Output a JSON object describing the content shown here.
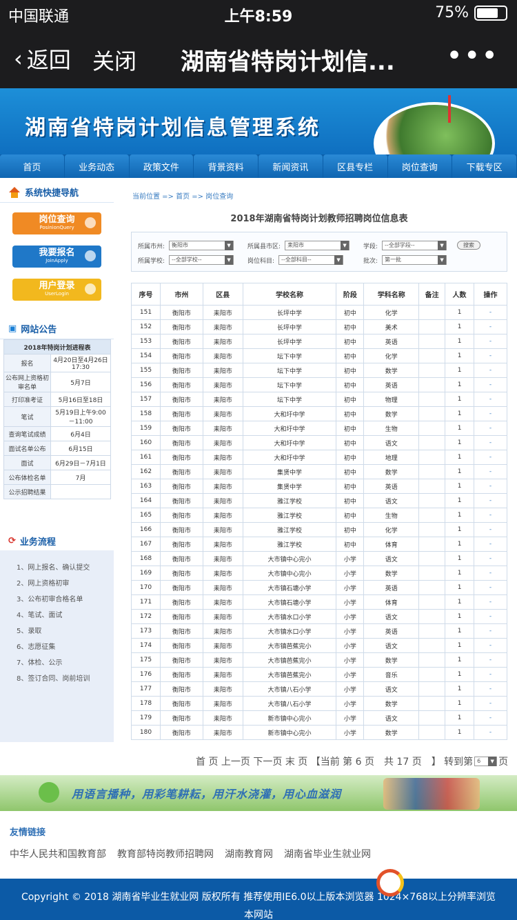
{
  "statusbar": {
    "carrier": "中国联通",
    "time": "上午8:59",
    "battery": "75%",
    "battery_level": 0.75
  },
  "navbar": {
    "back": "返回",
    "close": "关闭",
    "title": "湖南省特岗计划信...",
    "more": "•••"
  },
  "site": {
    "title": "湖南省特岗计划信息管理系统",
    "menu": [
      "首页",
      "业务动态",
      "政策文件",
      "背景资料",
      "新闻资讯",
      "区县专栏",
      "岗位查询",
      "下载专区"
    ]
  },
  "sidebar": {
    "quick_nav": "系统快捷导航",
    "buttons": [
      {
        "label": "岗位查询",
        "sub": "PosinionQuery",
        "color": "#f08a24"
      },
      {
        "label": "我要报名",
        "sub": "JoinApply",
        "color": "#1f78c8"
      },
      {
        "label": "用户登录",
        "sub": "UserLogin",
        "color": "#f2b81e"
      }
    ],
    "notice_title": "网站公告",
    "plan_caption": "2018年特岗计划进程表",
    "plan": [
      {
        "k": "报名",
        "v": "4月20日至4月26日17:30"
      },
      {
        "k": "公布网上资格初审名单",
        "v": "5月7日"
      },
      {
        "k": "打印准考证",
        "v": "5月16日至18日"
      },
      {
        "k": "笔试",
        "v": "5月19日上午9:00－11:00"
      },
      {
        "k": "查询笔试成绩",
        "v": "6月4日"
      },
      {
        "k": "面试名单公布",
        "v": "6月15日"
      },
      {
        "k": "面试",
        "v": "6月29日－7月1日"
      },
      {
        "k": "公布体检名单",
        "v": "7月"
      },
      {
        "k": "公示招聘结果",
        "v": ""
      }
    ],
    "flow_title": "业务流程",
    "flow": [
      "1、网上报名、确认提交",
      "2、网上资格初审",
      "3、公布初审合格名单",
      "4、笔试、面试",
      "5、录取",
      "6、志愿征集",
      "7、体检、公示",
      "8、签订合同、岗前培训"
    ]
  },
  "main": {
    "breadcrumb": "当前位置 => 首页 => 岗位查询",
    "heading": "2018年湖南省特岗计划教师招聘岗位信息表",
    "filters": {
      "city_label": "所属市州:",
      "city": "衡阳市",
      "county_label": "所属县市区:",
      "county": "耒阳市",
      "stage_label": "学段:",
      "stage": "--全部学段--",
      "search": "搜索",
      "school_label": "所属学校:",
      "school": "--全部学校--",
      "subject_label": "岗位科目:",
      "subject": "--全部科目--",
      "batch_label": "批次:",
      "batch": "第一批"
    },
    "columns": [
      "序号",
      "市州",
      "区县",
      "学校名称",
      "阶段",
      "学科名称",
      "备注",
      "人数",
      "操作"
    ],
    "rows": [
      [
        "151",
        "衡阳市",
        "耒阳市",
        "长坪中学",
        "初中",
        "化学",
        "",
        "1",
        "-"
      ],
      [
        "152",
        "衡阳市",
        "耒阳市",
        "长坪中学",
        "初中",
        "美术",
        "",
        "1",
        "-"
      ],
      [
        "153",
        "衡阳市",
        "耒阳市",
        "长坪中学",
        "初中",
        "英语",
        "",
        "1",
        "-"
      ],
      [
        "154",
        "衡阳市",
        "耒阳市",
        "坛下中学",
        "初中",
        "化学",
        "",
        "1",
        "-"
      ],
      [
        "155",
        "衡阳市",
        "耒阳市",
        "坛下中学",
        "初中",
        "数学",
        "",
        "1",
        "-"
      ],
      [
        "156",
        "衡阳市",
        "耒阳市",
        "坛下中学",
        "初中",
        "英语",
        "",
        "1",
        "-"
      ],
      [
        "157",
        "衡阳市",
        "耒阳市",
        "坛下中学",
        "初中",
        "物理",
        "",
        "1",
        "-"
      ],
      [
        "158",
        "衡阳市",
        "耒阳市",
        "大和圩中学",
        "初中",
        "数学",
        "",
        "1",
        "-"
      ],
      [
        "159",
        "衡阳市",
        "耒阳市",
        "大和圩中学",
        "初中",
        "生物",
        "",
        "1",
        "-"
      ],
      [
        "160",
        "衡阳市",
        "耒阳市",
        "大和圩中学",
        "初中",
        "语文",
        "",
        "1",
        "-"
      ],
      [
        "161",
        "衡阳市",
        "耒阳市",
        "大和圩中学",
        "初中",
        "地理",
        "",
        "1",
        "-"
      ],
      [
        "162",
        "衡阳市",
        "耒阳市",
        "集贤中学",
        "初中",
        "数学",
        "",
        "1",
        "-"
      ],
      [
        "163",
        "衡阳市",
        "耒阳市",
        "集贤中学",
        "初中",
        "英语",
        "",
        "1",
        "-"
      ],
      [
        "164",
        "衡阳市",
        "耒阳市",
        "雅江学校",
        "初中",
        "语文",
        "",
        "1",
        "-"
      ],
      [
        "165",
        "衡阳市",
        "耒阳市",
        "雅江学校",
        "初中",
        "生物",
        "",
        "1",
        "-"
      ],
      [
        "166",
        "衡阳市",
        "耒阳市",
        "雅江学校",
        "初中",
        "化学",
        "",
        "1",
        "-"
      ],
      [
        "167",
        "衡阳市",
        "耒阳市",
        "雅江学校",
        "初中",
        "体育",
        "",
        "1",
        "-"
      ],
      [
        "168",
        "衡阳市",
        "耒阳市",
        "大市镇中心完小",
        "小学",
        "语文",
        "",
        "1",
        "-"
      ],
      [
        "169",
        "衡阳市",
        "耒阳市",
        "大市镇中心完小",
        "小学",
        "数学",
        "",
        "1",
        "-"
      ],
      [
        "170",
        "衡阳市",
        "耒阳市",
        "大市镇石塘小学",
        "小学",
        "英语",
        "",
        "1",
        "-"
      ],
      [
        "171",
        "衡阳市",
        "耒阳市",
        "大市镇石塘小学",
        "小学",
        "体育",
        "",
        "1",
        "-"
      ],
      [
        "172",
        "衡阳市",
        "耒阳市",
        "大市镇水口小学",
        "小学",
        "语文",
        "",
        "1",
        "-"
      ],
      [
        "173",
        "衡阳市",
        "耒阳市",
        "大市镇水口小学",
        "小学",
        "英语",
        "",
        "1",
        "-"
      ],
      [
        "174",
        "衡阳市",
        "耒阳市",
        "大市镇芭蕉完小",
        "小学",
        "语文",
        "",
        "1",
        "-"
      ],
      [
        "175",
        "衡阳市",
        "耒阳市",
        "大市镇芭蕉完小",
        "小学",
        "数学",
        "",
        "1",
        "-"
      ],
      [
        "176",
        "衡阳市",
        "耒阳市",
        "大市镇芭蕉完小",
        "小学",
        "音乐",
        "",
        "1",
        "-"
      ],
      [
        "177",
        "衡阳市",
        "耒阳市",
        "大市镇八石小学",
        "小学",
        "语文",
        "",
        "1",
        "-"
      ],
      [
        "178",
        "衡阳市",
        "耒阳市",
        "大市镇八石小学",
        "小学",
        "数学",
        "",
        "1",
        "-"
      ],
      [
        "179",
        "衡阳市",
        "耒阳市",
        "新市镇中心完小",
        "小学",
        "语文",
        "",
        "1",
        "-"
      ],
      [
        "180",
        "衡阳市",
        "耒阳市",
        "新市镇中心完小",
        "小学",
        "数学",
        "",
        "1",
        "-"
      ]
    ],
    "pager": {
      "first": "首 页",
      "prev": "上一页",
      "next": "下一页",
      "last": "末 页",
      "status": "【当前 第 6 页　共 17 页　】",
      "goto": "转到第",
      "page": "6",
      "suffix": "页"
    }
  },
  "slogan": "用语言播种，用彩笔耕耘，用汗水浇灌，用心血滋润",
  "links": {
    "title": "友情链接",
    "items": [
      "中华人民共和国教育部",
      "教育部特岗教师招聘网",
      "湖南教育网",
      "湖南省毕业生就业网"
    ]
  },
  "footer": {
    "line1": "Copyright © 2018 湖南省毕业生就业网 版权所有 推荐使用IE6.0以上版本浏览器 1024×768以上分辨率浏览",
    "line2": "本网站"
  }
}
